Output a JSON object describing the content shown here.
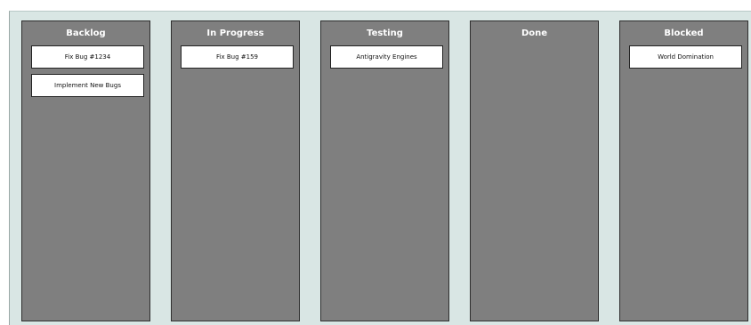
{
  "board": {
    "columns": [
      {
        "title": "Backlog",
        "cards": [
          "Fix Bug #1234",
          "Implement New Bugs"
        ]
      },
      {
        "title": "In Progress",
        "cards": [
          "Fix Bug #159"
        ]
      },
      {
        "title": "Testing",
        "cards": [
          "Antigravity Engines"
        ]
      },
      {
        "title": "Done",
        "cards": []
      },
      {
        "title": "Blocked",
        "cards": [
          "World Domination"
        ]
      }
    ]
  },
  "colors": {
    "board_background": "#d9e6e4",
    "column_background": "#7f7f7f",
    "card_background": "#ffffff"
  }
}
